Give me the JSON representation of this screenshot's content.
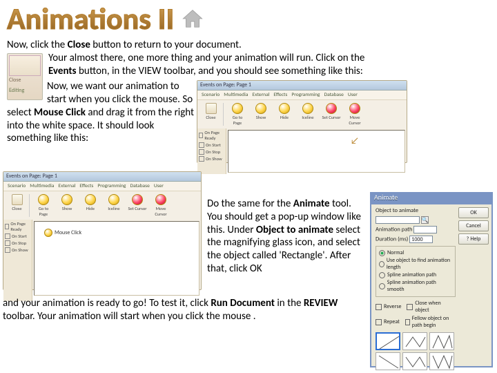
{
  "title": "Animations II",
  "paragraphs": {
    "p1_a": "Now, click the ",
    "p1_b": "Close",
    "p1_c": " button to return to your document.",
    "p2_a": "Your almost there, one more thing and your animation will run.  Click on the ",
    "p2_b": "Events",
    "p2_c": " button, in the VIEW toolbar, and you should see something like this:",
    "p3_a": "Now, we want our animation to start when you click the mouse.  So select ",
    "p3_b": "Mouse Click",
    "p3_c": " and drag it from the right into the white space.  It should look something like this:",
    "p4_a": "Do the same for the ",
    "p4_b": "Animate",
    "p4_c": " tool.  You should get a pop-up window like this.  Under ",
    "p4_d": "Object to animate",
    "p4_e": " select the magnifying glass icon, and select the object called 'Rectangle'.  After that, click OK",
    "p5_a": "and your animation is ready to go!  To test it, click ",
    "p5_b": "Run Document",
    "p5_c": " in the ",
    "p5_d": "REVIEW",
    "p5_e": " toolbar.  Your animation will start when you click the mouse ."
  },
  "toolbox_small": {
    "line1": "Close",
    "line2": "Editing"
  },
  "events_panel": {
    "header": "Events on Page: Page 1",
    "tabs": [
      "Scenario",
      "Multimedia",
      "External",
      "Effects",
      "Programming",
      "Database",
      "User"
    ],
    "icons": [
      "Go to Page",
      "Show",
      "Hide",
      "Iceline",
      "Set Cursor",
      "Move Cursor"
    ],
    "close_btn_inside": "Close",
    "side_items": [
      "On Page Ready",
      "On Start",
      "On Stop",
      "On Show"
    ]
  },
  "events_panel2": {
    "header": "Events on Page: Page 1",
    "dragged_item": "Mouse Click"
  },
  "animate_dialog": {
    "title": "Animate",
    "labels": {
      "object": "Object to animate",
      "anim_path": "Animation path",
      "duration": "Duration (ms)",
      "duration_value": "1000"
    },
    "buttons": {
      "ok": "OK",
      "cancel": "Cancel",
      "help": "Help"
    },
    "radios": [
      "Normal",
      "Use object to find animation length",
      "Spline animation path",
      "Spline animation path smooth"
    ],
    "checks": [
      "Reverse",
      "Close when object",
      "Repeat",
      "Fellow object on path begin"
    ]
  }
}
